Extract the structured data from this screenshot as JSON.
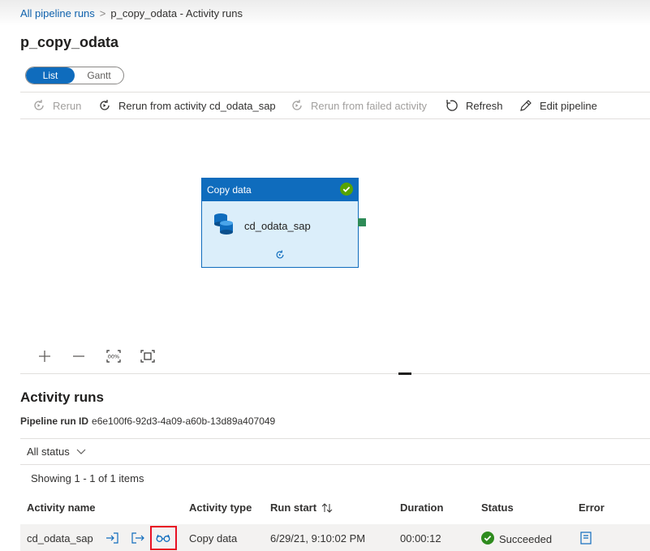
{
  "breadcrumb": {
    "root": "All pipeline runs",
    "separator": ">",
    "current": "p_copy_odata - Activity runs"
  },
  "page_title": "p_copy_odata",
  "view_toggle": {
    "list": "List",
    "gantt": "Gantt",
    "selected": "List"
  },
  "toolbar": {
    "rerun": "Rerun",
    "rerun_from_activity": "Rerun from activity cd_odata_sap",
    "rerun_from_failed": "Rerun from failed activity",
    "refresh": "Refresh",
    "edit_pipeline": "Edit pipeline"
  },
  "canvas": {
    "node": {
      "type": "Copy data",
      "name": "cd_odata_sap",
      "status_icon": "success-check-icon"
    }
  },
  "activity_runs": {
    "title": "Activity runs",
    "run_id_label": "Pipeline run ID",
    "run_id": "e6e100f6-92d3-4a09-a60b-13d89a407049",
    "status_filter": "All status",
    "showing": "Showing 1 - 1 of 1 items",
    "columns": [
      "Activity name",
      "Activity type",
      "Run start",
      "Duration",
      "Status",
      "Error"
    ],
    "rows": [
      {
        "activity_name": "cd_odata_sap",
        "activity_type": "Copy data",
        "run_start": "6/29/21, 9:10:02 PM",
        "duration": "00:00:12",
        "status": "Succeeded"
      }
    ]
  },
  "colors": {
    "accent": "#0f6cbd",
    "success": "#2e8b1e",
    "highlight_border": "#e81123"
  }
}
